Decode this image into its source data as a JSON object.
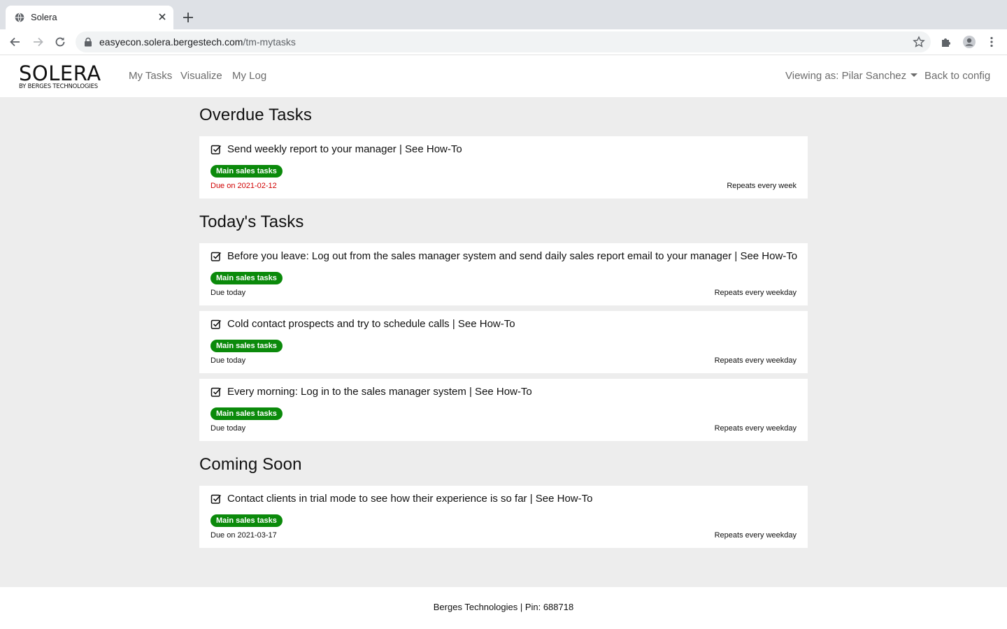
{
  "browser": {
    "tab_title": "Solera",
    "url_host": "easyecon.solera.bergestech.com",
    "url_path": "/tm-mytasks"
  },
  "nav": {
    "logo_main": "SOLERA",
    "logo_sub": "BY BERGES TECHNOLOGIES",
    "links": [
      "My Tasks",
      "Visualize",
      "My Log"
    ],
    "viewing_as": "Viewing as: Pilar Sanchez",
    "back": "Back to config"
  },
  "sections": [
    {
      "title": "Overdue Tasks",
      "tasks": [
        {
          "text": "Send weekly report to your manager | See How-To",
          "tag": "Main sales tasks",
          "due": "Due on 2021-02-12",
          "repeat": "Repeats every week"
        }
      ]
    },
    {
      "title": "Today's Tasks",
      "tasks": [
        {
          "text": "Before you leave: Log out from the sales manager system and send daily sales report email to your manager | See How-To",
          "tag": "Main sales tasks",
          "due": "Due today",
          "repeat": "Repeats every weekday"
        },
        {
          "text": "Cold contact prospects and try to schedule calls | See How-To",
          "tag": "Main sales tasks",
          "due": "Due today",
          "repeat": "Repeats every weekday"
        },
        {
          "text": "Every morning: Log in to the sales manager system | See How-To",
          "tag": "Main sales tasks",
          "due": "Due today",
          "repeat": "Repeats every weekday"
        }
      ]
    },
    {
      "title": "Coming Soon",
      "tasks": [
        {
          "text": "Contact clients in trial mode to see how their experience is so far | See How-To",
          "tag": "Main sales tasks",
          "due": "Due on 2021-03-17",
          "repeat": "Repeats every weekday"
        }
      ]
    }
  ],
  "footer": "Berges Technologies | Pin: 688718",
  "colors": {
    "tag": "#0b8a0b",
    "overdue": "#d00000"
  }
}
